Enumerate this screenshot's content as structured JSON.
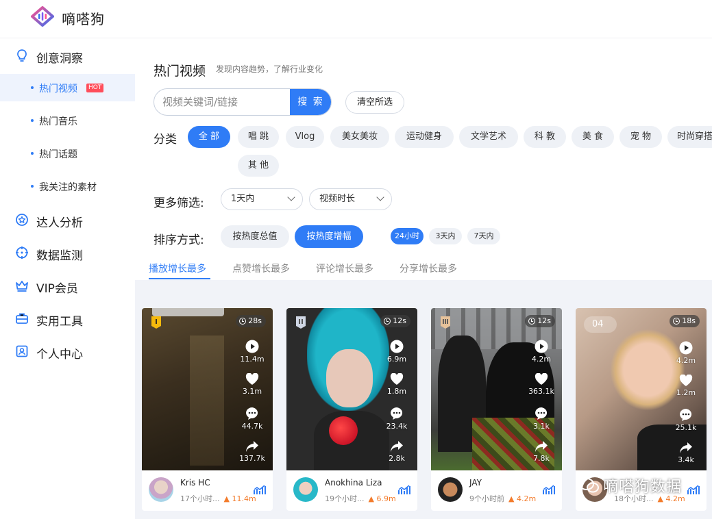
{
  "app": {
    "brand": "嘀嗒狗"
  },
  "sidebar": {
    "groups": [
      {
        "label": "创意洞察",
        "icon": "lightbulb-icon"
      },
      {
        "label": "达人分析",
        "icon": "star-badge-icon"
      },
      {
        "label": "数据监测",
        "icon": "crosshair-icon"
      },
      {
        "label": "VIP会员",
        "icon": "crown-icon"
      },
      {
        "label": "实用工具",
        "icon": "toolbox-icon"
      },
      {
        "label": "个人中心",
        "icon": "user-card-icon"
      }
    ],
    "sub_items": [
      {
        "label": "热门视频",
        "badge": "HOT",
        "active": true
      },
      {
        "label": "热门音乐"
      },
      {
        "label": "热门话题"
      },
      {
        "label": "我关注的素材"
      }
    ]
  },
  "page": {
    "title": "热门视频",
    "subtitle": "发现内容趋势，了解行业变化",
    "search": {
      "placeholder": "视频关键词/链接",
      "button": "搜 索"
    },
    "clear_button": "清空所选",
    "category_label": "分类",
    "categories": [
      "全 部",
      "唱 跳",
      "Vlog",
      "美女美妆",
      "运动健身",
      "文学艺术",
      "科 教",
      "美 食",
      "宠 物",
      "时尚穿搭",
      "其 他"
    ],
    "filter_label": "更多筛选:",
    "filters": [
      {
        "value": "1天内"
      },
      {
        "value": "视频时长"
      }
    ],
    "sort_label": "排序方式:",
    "sort_options": [
      "按热度总值",
      "按热度增幅"
    ],
    "time_ranges": [
      "24小时",
      "3天内",
      "7天内"
    ],
    "tabs": [
      "播放增长最多",
      "点赞增长最多",
      "评论增长最多",
      "分享增长最多"
    ]
  },
  "videos": [
    {
      "duration": "28s",
      "plays": "11.4m",
      "likes": "3.1m",
      "comments": "44.7k",
      "shares": "137.7k",
      "author": "Kris HC",
      "time": "17个小时...",
      "growth": "▲ 11.4m"
    },
    {
      "duration": "12s",
      "plays": "6.9m",
      "likes": "1.8m",
      "comments": "23.4k",
      "shares": "2.8k",
      "author": "Anokhina Liza",
      "time": "19个小时...",
      "growth": "▲ 6.9m"
    },
    {
      "duration": "12s",
      "plays": "4.2m",
      "likes": "363.1k",
      "comments": "3.1k",
      "shares": "7.8k",
      "author": "JAY",
      "time": "9个小时前",
      "growth": "▲ 4.2m"
    },
    {
      "duration": "18s",
      "rank": "04",
      "plays": "4.2m",
      "likes": "1.2m",
      "comments": "25.1k",
      "shares": "3.4k",
      "author": "",
      "time": "18个小时...",
      "growth": "▲ 4.2m"
    }
  ],
  "watermark": "嘀嗒狗数据",
  "colors": {
    "accent": "#2f7cf6",
    "hot": "#ff4d5a",
    "growth": "#f37b2b"
  }
}
